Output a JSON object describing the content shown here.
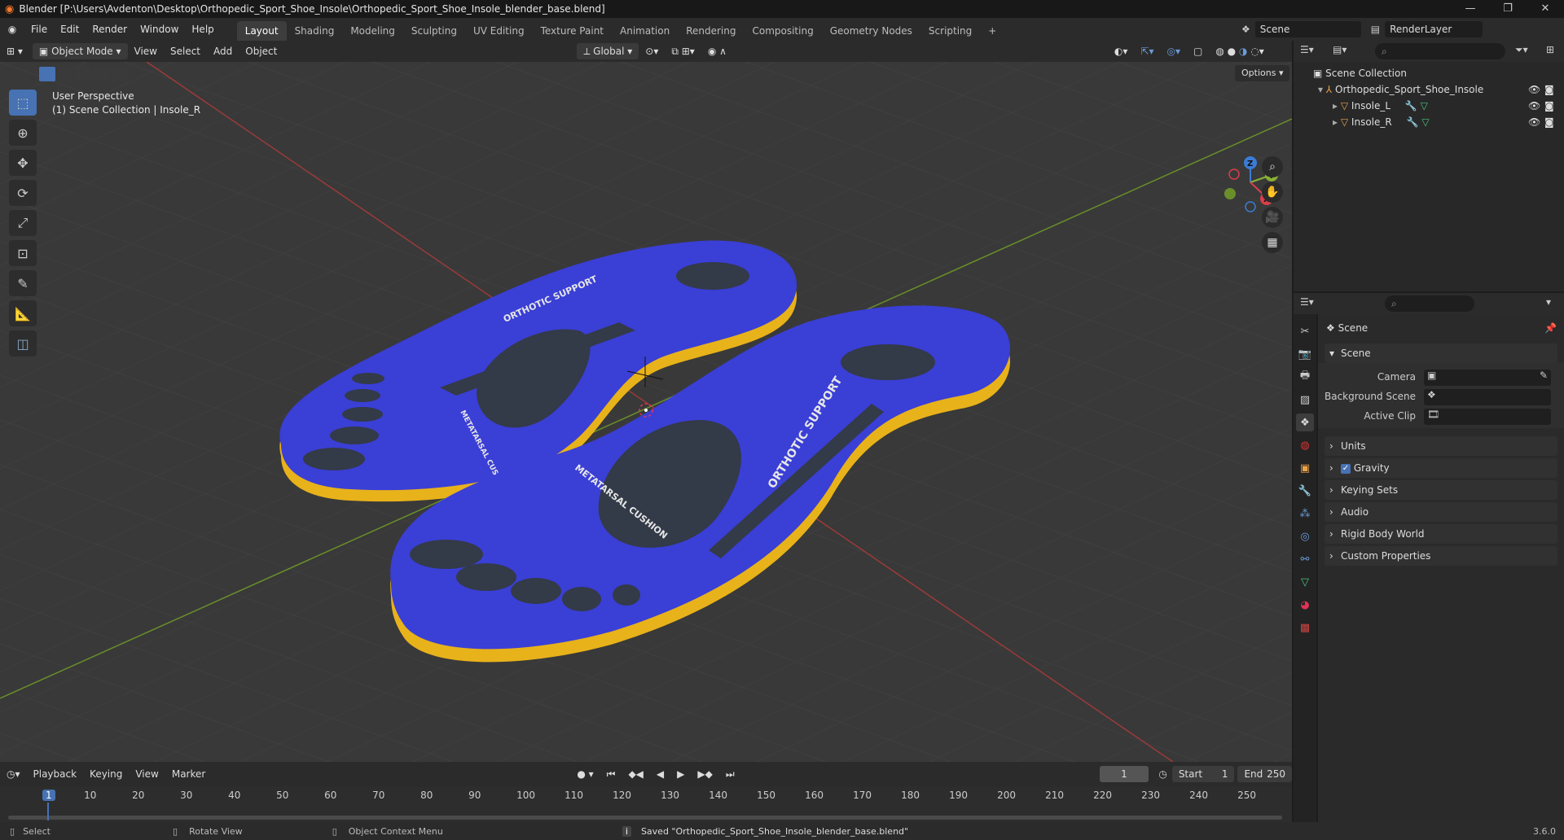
{
  "window": {
    "title": "Blender [P:\\Users\\Avdenton\\Desktop\\Orthopedic_Sport_Shoe_Insole\\Orthopedic_Sport_Shoe_Insole_blender_base.blend]",
    "minimize": "—",
    "maximize": "❐",
    "close": "✕"
  },
  "menu": [
    "File",
    "Edit",
    "Render",
    "Window",
    "Help"
  ],
  "workspaces": {
    "active": "Layout",
    "tabs": [
      "Layout",
      "Shading",
      "Modeling",
      "Sculpting",
      "UV Editing",
      "Texture Paint",
      "Animation",
      "Rendering",
      "Compositing",
      "Geometry Nodes",
      "Scripting"
    ],
    "add": "+"
  },
  "scene_selector": {
    "scene": "Scene",
    "layer": "RenderLayer"
  },
  "viewport_header": {
    "mode": "Object Mode",
    "menus": [
      "View",
      "Select",
      "Add",
      "Object"
    ],
    "transform_orientation": "Global"
  },
  "viewport": {
    "perspective": "User Perspective",
    "collection_info": "(1) Scene Collection | Insole_R",
    "options": "Options",
    "gizmo": {
      "z": "Z",
      "y": "Y",
      "x": "X"
    }
  },
  "insole_text": {
    "support": "ORTHOTIC SUPPORT",
    "cushion": "METATARSAL CUSHION"
  },
  "colors": {
    "insole_top": "#3a3fd6",
    "insole_edge": "#e8b21a",
    "pads": "#333a48",
    "grid": "#444444",
    "x_axis": "#9c3a3a",
    "y_axis": "#6a8f2a",
    "accent": "#4772b3"
  },
  "outliner": {
    "root": "Scene Collection",
    "items": [
      {
        "name": "Orthopedic_Sport_Shoe_Insole",
        "level": 1
      },
      {
        "name": "Insole_L",
        "level": 2
      },
      {
        "name": "Insole_R",
        "level": 2
      }
    ]
  },
  "properties": {
    "context": "Scene",
    "section": "Scene",
    "fields": [
      {
        "label": "Camera"
      },
      {
        "label": "Background Scene"
      },
      {
        "label": "Active Clip"
      }
    ],
    "panels": [
      {
        "label": "Units",
        "checkbox": false
      },
      {
        "label": "Gravity",
        "checkbox": true
      },
      {
        "label": "Keying Sets",
        "checkbox": false
      },
      {
        "label": "Audio",
        "checkbox": false
      },
      {
        "label": "Rigid Body World",
        "checkbox": false
      },
      {
        "label": "Custom Properties",
        "checkbox": false
      }
    ]
  },
  "timeline": {
    "menus": [
      "Playback",
      "Keying",
      "View",
      "Marker"
    ],
    "current_frame": "1",
    "start_label": "Start",
    "start": "1",
    "end_label": "End",
    "end": "250",
    "ticks": [
      "1",
      "10",
      "20",
      "30",
      "40",
      "50",
      "60",
      "70",
      "80",
      "90",
      "100",
      "110",
      "120",
      "130",
      "140",
      "150",
      "160",
      "170",
      "180",
      "190",
      "200",
      "210",
      "220",
      "230",
      "240",
      "250"
    ]
  },
  "statusbar": {
    "select": "Select",
    "rotate": "Rotate View",
    "context_menu": "Object Context Menu",
    "message": "Saved \"Orthopedic_Sport_Shoe_Insole_blender_base.blend\"",
    "version": "3.6.0"
  }
}
